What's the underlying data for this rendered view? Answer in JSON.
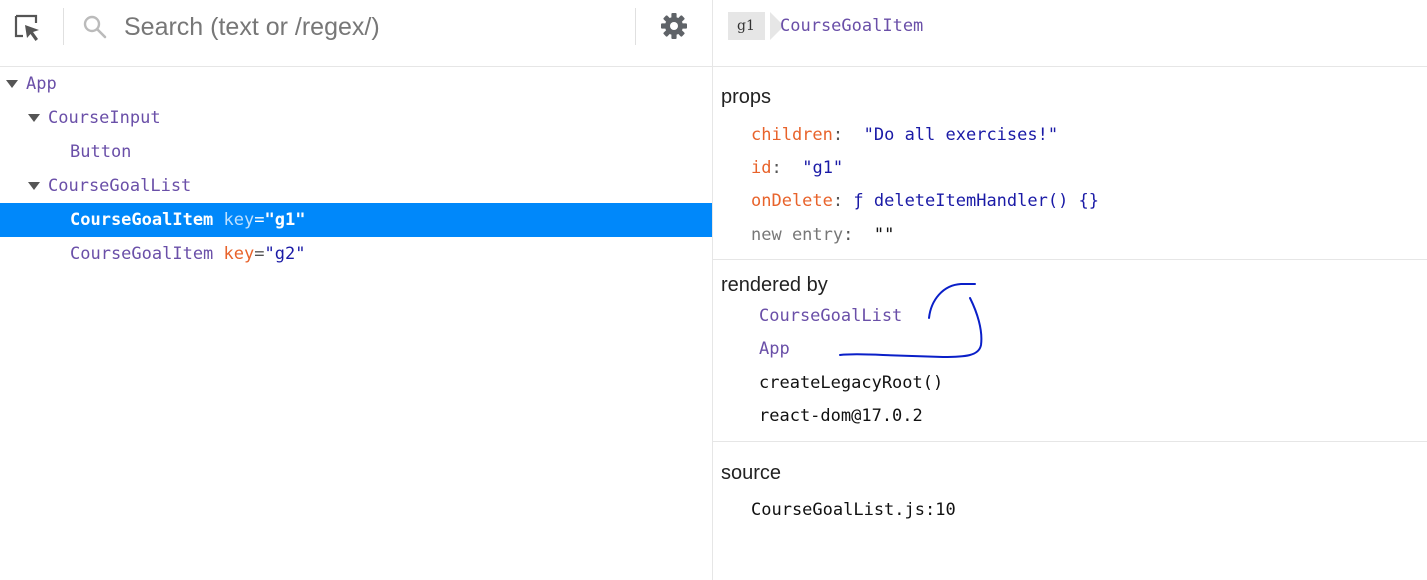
{
  "toolbar": {
    "search_placeholder": "Search (text or /regex/)"
  },
  "tree": [
    {
      "name": "App",
      "depth": 0,
      "expanded": true,
      "key": null,
      "selected": false
    },
    {
      "name": "CourseInput",
      "depth": 1,
      "expanded": true,
      "key": null,
      "selected": false
    },
    {
      "name": "Button",
      "depth": 2,
      "expanded": null,
      "key": null,
      "selected": false
    },
    {
      "name": "CourseGoalList",
      "depth": 1,
      "expanded": true,
      "key": null,
      "selected": false
    },
    {
      "name": "CourseGoalItem",
      "depth": 2,
      "expanded": null,
      "key": "\"g1\"",
      "selected": true
    },
    {
      "name": "CourseGoalItem",
      "depth": 2,
      "expanded": null,
      "key": "\"g2\"",
      "selected": false
    }
  ],
  "tree_labels": {
    "key_label": "key",
    "key_eq": "="
  },
  "inspector": {
    "badge": "g1",
    "title": "CourseGoalItem",
    "props_title": "props",
    "props": [
      {
        "key": "children",
        "value": "\"Do all exercises!\"",
        "kind": "string"
      },
      {
        "key": "id",
        "value": "\"g1\"",
        "kind": "string"
      },
      {
        "key": "onDelete",
        "value": "ƒ deleteItemHandler() {}",
        "kind": "function"
      }
    ],
    "new_entry": {
      "key": "new entry",
      "value": "\"\""
    },
    "colon": ":",
    "rendered_by_title": "rendered by",
    "rendered_by": [
      {
        "label": "CourseGoalList",
        "kind": "component"
      },
      {
        "label": "App",
        "kind": "component"
      },
      {
        "label": "createLegacyRoot()",
        "kind": "plain"
      },
      {
        "label": "react-dom@17.0.2",
        "kind": "plain"
      }
    ],
    "source_title": "source",
    "source": "CourseGoalList.js:10"
  },
  "colors": {
    "selection": "#0088fa",
    "component": "#6a4fa8",
    "prop_key": "#e8632b",
    "string_value": "#1a1aa6",
    "annotation_ink": "#0a1fc8"
  }
}
